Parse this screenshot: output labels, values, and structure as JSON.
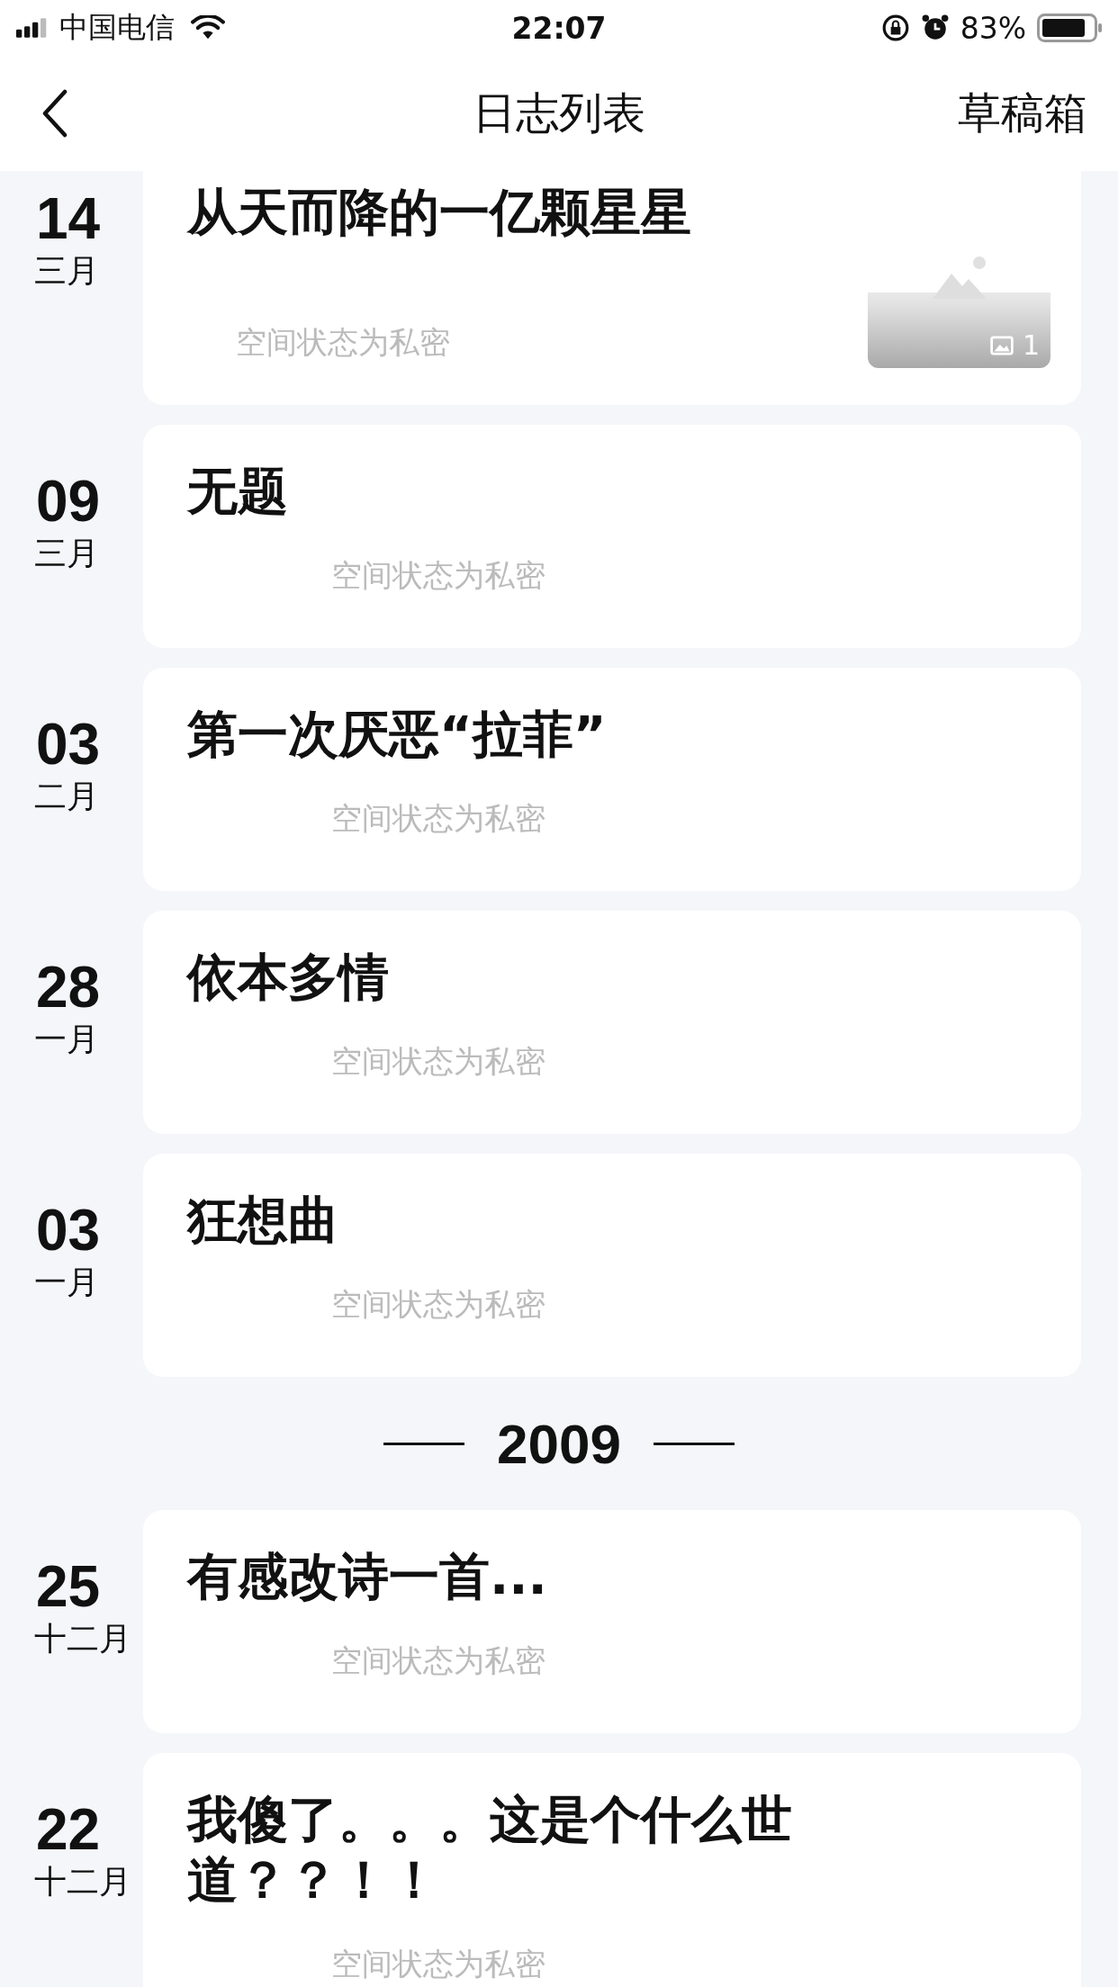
{
  "status_bar": {
    "carrier": "中国电信",
    "time": "22:07",
    "battery": "83%"
  },
  "nav": {
    "title": "日志列表",
    "action": "草稿箱"
  },
  "groups": [
    {
      "entries": [
        {
          "day": "14",
          "month": "三月",
          "title": "从天而降的一亿颗星星",
          "status": "空间状态为私密",
          "image_count": "1"
        },
        {
          "day": "09",
          "month": "三月",
          "title": "无题",
          "status": "空间状态为私密"
        },
        {
          "day": "03",
          "month": "二月",
          "title": "第一次厌恶“拉菲”",
          "status": "空间状态为私密"
        },
        {
          "day": "28",
          "month": "一月",
          "title": "依本多情",
          "status": "空间状态为私密"
        },
        {
          "day": "03",
          "month": "一月",
          "title": "狂想曲",
          "status": "空间状态为私密"
        }
      ]
    },
    {
      "year": "2009",
      "entries": [
        {
          "day": "25",
          "month": "十二月",
          "title": "有感改诗一首...",
          "status": "空间状态为私密"
        },
        {
          "day": "22",
          "month": "十二月",
          "title": "我傻了。。。这是个什么世道？？！！",
          "status": "空间状态为私密"
        }
      ]
    }
  ]
}
